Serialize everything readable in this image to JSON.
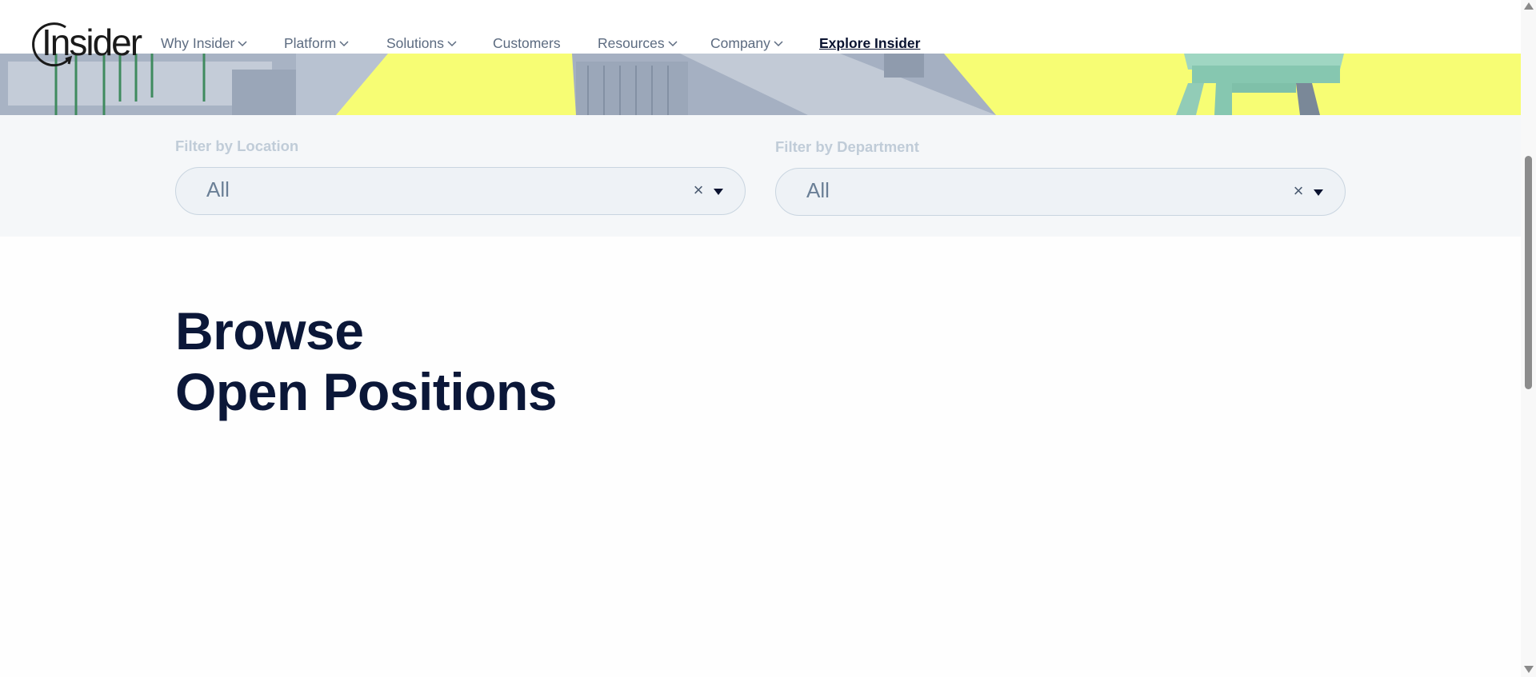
{
  "header": {
    "logo_text": "Insider",
    "nav": [
      {
        "label": "Why Insider",
        "has_dropdown": true
      },
      {
        "label": "Platform",
        "has_dropdown": true
      },
      {
        "label": "Solutions",
        "has_dropdown": true
      },
      {
        "label": "Customers",
        "has_dropdown": false
      },
      {
        "label": "Resources",
        "has_dropdown": true
      },
      {
        "label": "Company",
        "has_dropdown": true
      },
      {
        "label": "Explore Insider",
        "has_dropdown": false
      }
    ]
  },
  "filters": {
    "location": {
      "label": "Filter by Location",
      "value": "All",
      "clear_icon": "close-icon",
      "arrow_icon": "caret-down-icon"
    },
    "department": {
      "label": "Filter by Department",
      "value": "All",
      "clear_icon": "close-icon",
      "arrow_icon": "caret-down-icon"
    }
  },
  "main": {
    "headline_line1": "Browse",
    "headline_line2": "Open Positions"
  },
  "colors": {
    "hero_yellow": "#f7fd74",
    "headline_navy": "#0b1738",
    "nav_gray": "#5c6b80",
    "filter_bg": "#f5f7f9"
  }
}
